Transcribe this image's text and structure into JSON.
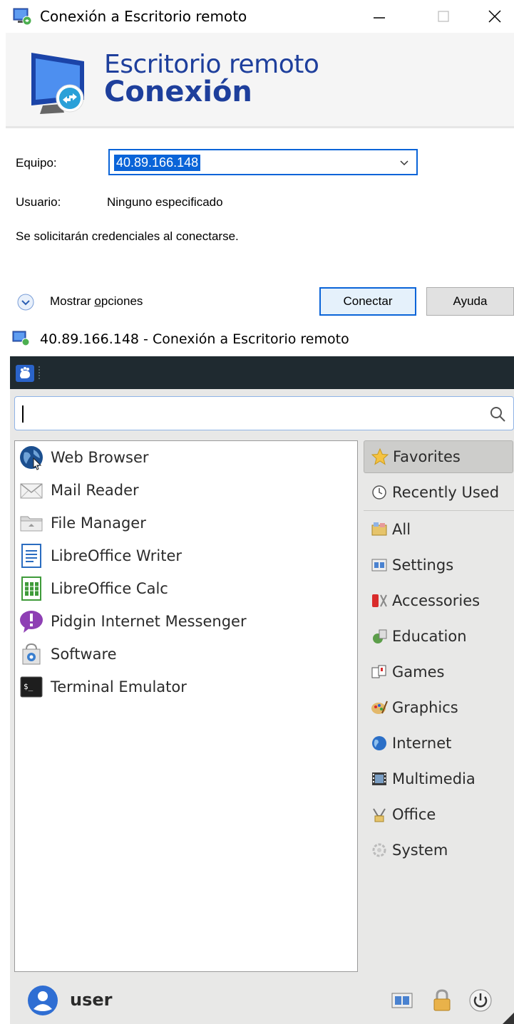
{
  "rdp_dialog": {
    "title": "Conexión a Escritorio remoto",
    "banner_line1": "Escritorio remoto",
    "banner_line2": "Conexión",
    "equipo_label": "Equipo:",
    "equipo_value": "40.89.166.148",
    "usuario_label": "Usuario:",
    "usuario_value": "Ninguno especificado",
    "info_text": "Se solicitarán credenciales al conectarse.",
    "options_prefix": "Mostrar ",
    "options_mnemonic": "o",
    "options_suffix": "pciones",
    "connect_label": "Conectar",
    "help_label": "Ayuda"
  },
  "session": {
    "title": "40.89.166.148 - Conexión a Escritorio remoto"
  },
  "whisker_menu": {
    "search_value": "",
    "apps": [
      {
        "label": "Web Browser",
        "icon": "globe-icon"
      },
      {
        "label": "Mail Reader",
        "icon": "mail-icon"
      },
      {
        "label": "File Manager",
        "icon": "folder-icon"
      },
      {
        "label": "LibreOffice Writer",
        "icon": "writer-icon"
      },
      {
        "label": "LibreOffice Calc",
        "icon": "calc-icon"
      },
      {
        "label": "Pidgin Internet Messenger",
        "icon": "pidgin-icon"
      },
      {
        "label": "Software",
        "icon": "software-icon"
      },
      {
        "label": "Terminal Emulator",
        "icon": "terminal-icon"
      }
    ],
    "categories": [
      {
        "label": "Favorites",
        "icon": "star-icon"
      },
      {
        "label": "Recently Used",
        "icon": "clock-icon"
      },
      {
        "label": "All",
        "icon": "all-icon"
      },
      {
        "label": "Settings",
        "icon": "settings-icon"
      },
      {
        "label": "Accessories",
        "icon": "accessories-icon"
      },
      {
        "label": "Education",
        "icon": "education-icon"
      },
      {
        "label": "Games",
        "icon": "games-icon"
      },
      {
        "label": "Graphics",
        "icon": "graphics-icon"
      },
      {
        "label": "Internet",
        "icon": "internet-icon"
      },
      {
        "label": "Multimedia",
        "icon": "multimedia-icon"
      },
      {
        "label": "Office",
        "icon": "office-icon"
      },
      {
        "label": "System",
        "icon": "system-icon"
      }
    ],
    "user_name": "user",
    "colors": {
      "panel": "#1f2a30",
      "menu_bg": "#e8e8e7",
      "accent": "#0a64d8",
      "banner_text": "#1e3f9c"
    }
  }
}
